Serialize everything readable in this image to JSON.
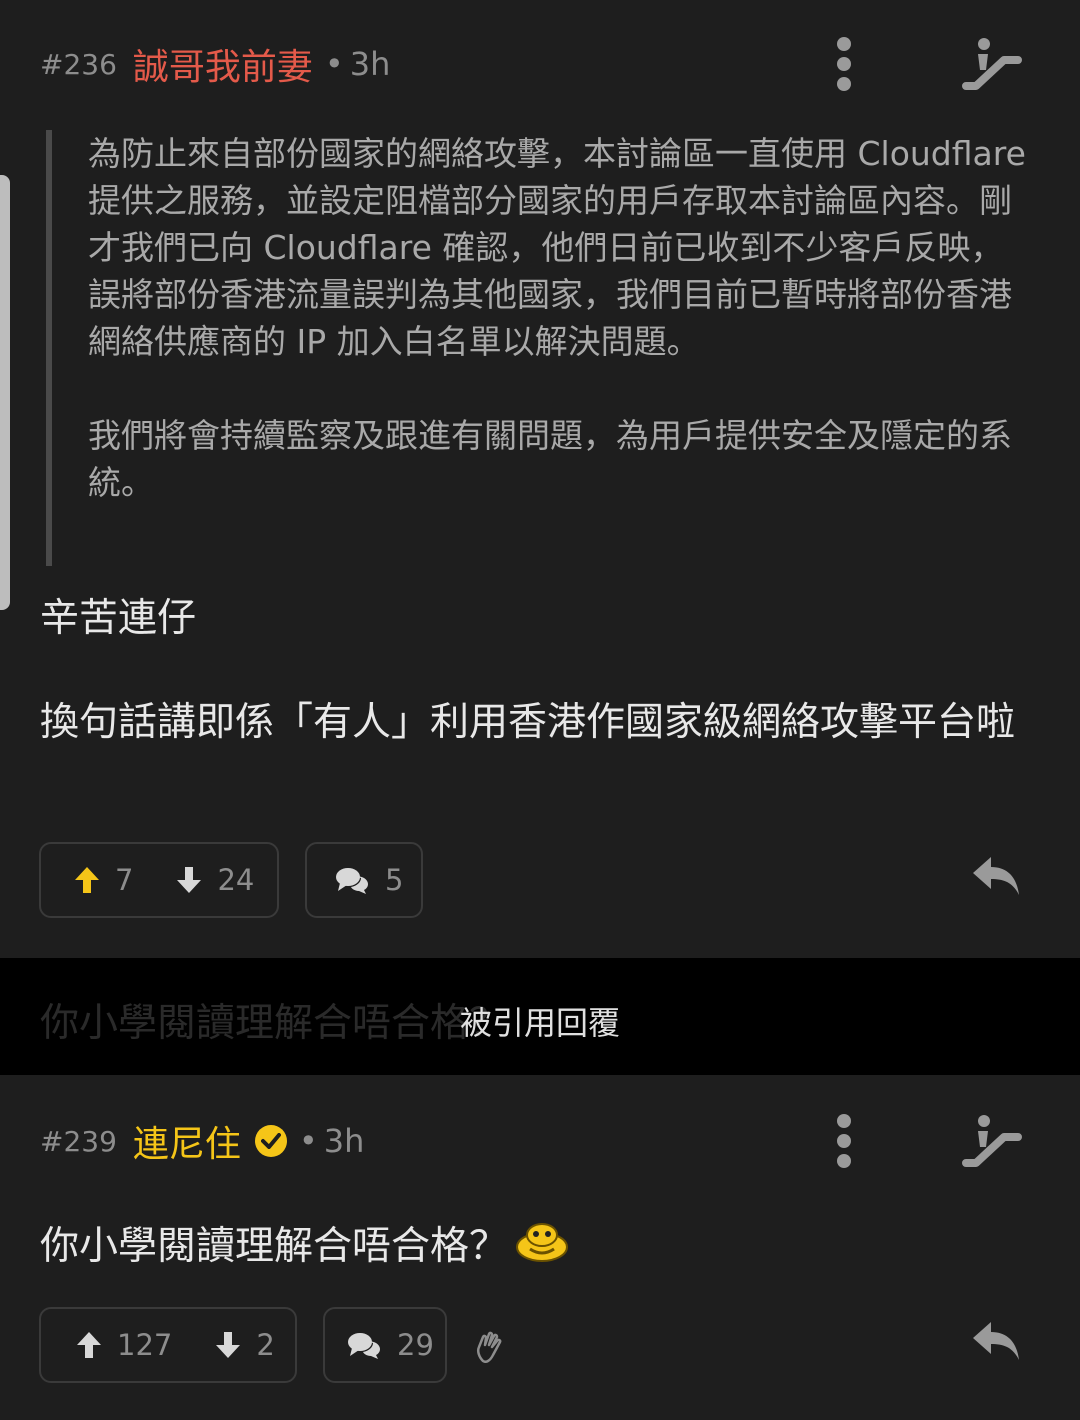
{
  "colors": {
    "background": "#1e1e1e",
    "username_red": "#e45a4a",
    "username_gold": "#f5c518",
    "upvote_active": "#f5c518",
    "muted": "#8d8d8d"
  },
  "posts": [
    {
      "number": "#236",
      "username": "誠哥我前妻",
      "time_sep": "•",
      "time": "3h",
      "quote": [
        "為防止來自部份國家的網絡攻擊，本討論區一直使用 Cloudflare 提供之服務，並設定阻檔部分國家的用戶存取本討論區內容。剛才我們已向 Cloudflare 確認，他們日前已收到不少客戶反映，誤將部份香港流量誤判為其他國家，我們目前已暫時將部份香港網絡供應商的 IP 加入白名單以解決問題。",
        "我們將會持續監察及跟進有關問題，為用戶提供安全及隱定的系統。"
      ],
      "body": [
        "辛苦連仔",
        "換句話講即係「有人」利用香港作國家級網絡攻擊平台啦"
      ],
      "upvotes": "7",
      "downvotes": "24",
      "comments": "5",
      "icons": [
        "more-vertical-icon",
        "escalator-icon",
        "upvote-arrow-icon",
        "downvote-arrow-icon",
        "comment-bubbles-icon",
        "reply-icon"
      ]
    },
    {
      "number": "#239",
      "username": "連尼住",
      "time_sep": "•",
      "time": "3h",
      "body": "你小學閱讀理解合唔合格？",
      "upvotes": "127",
      "downvotes": "2",
      "comments": "29",
      "icons": [
        "more-vertical-icon",
        "escalator-icon",
        "verified-check-icon",
        "emoji-sticker-icon",
        "clap-hand-icon",
        "reply-icon"
      ]
    }
  ],
  "quoted_banner": {
    "ghost_text": "你小學閱讀理解合唔合格？",
    "label": "被引用回覆"
  }
}
